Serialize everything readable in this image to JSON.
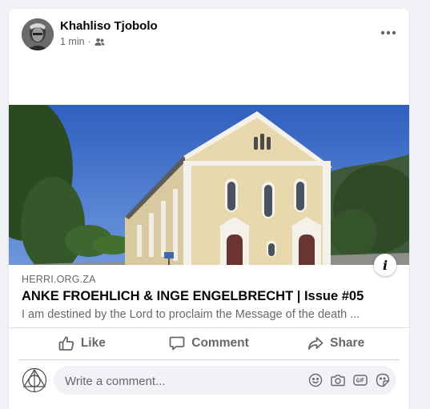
{
  "post": {
    "author": "Khahliso Tjobolo",
    "time": "1 min",
    "separator": "·",
    "audience_icon": "friends-icon"
  },
  "link": {
    "domain": "HERRI.ORG.ZA",
    "headline": "ANKE FROEHLICH & INGE ENGELBRECHT | Issue #05",
    "description": "I am destined by the Lord to proclaim the Message of the death ..."
  },
  "actions": {
    "like": "Like",
    "comment": "Comment",
    "share": "Share"
  },
  "comment_box": {
    "placeholder": "Write a comment..."
  },
  "info_label": "i",
  "colors": {
    "text_primary": "#050505",
    "text_secondary": "#65676b",
    "background": "#f0f2f5"
  }
}
